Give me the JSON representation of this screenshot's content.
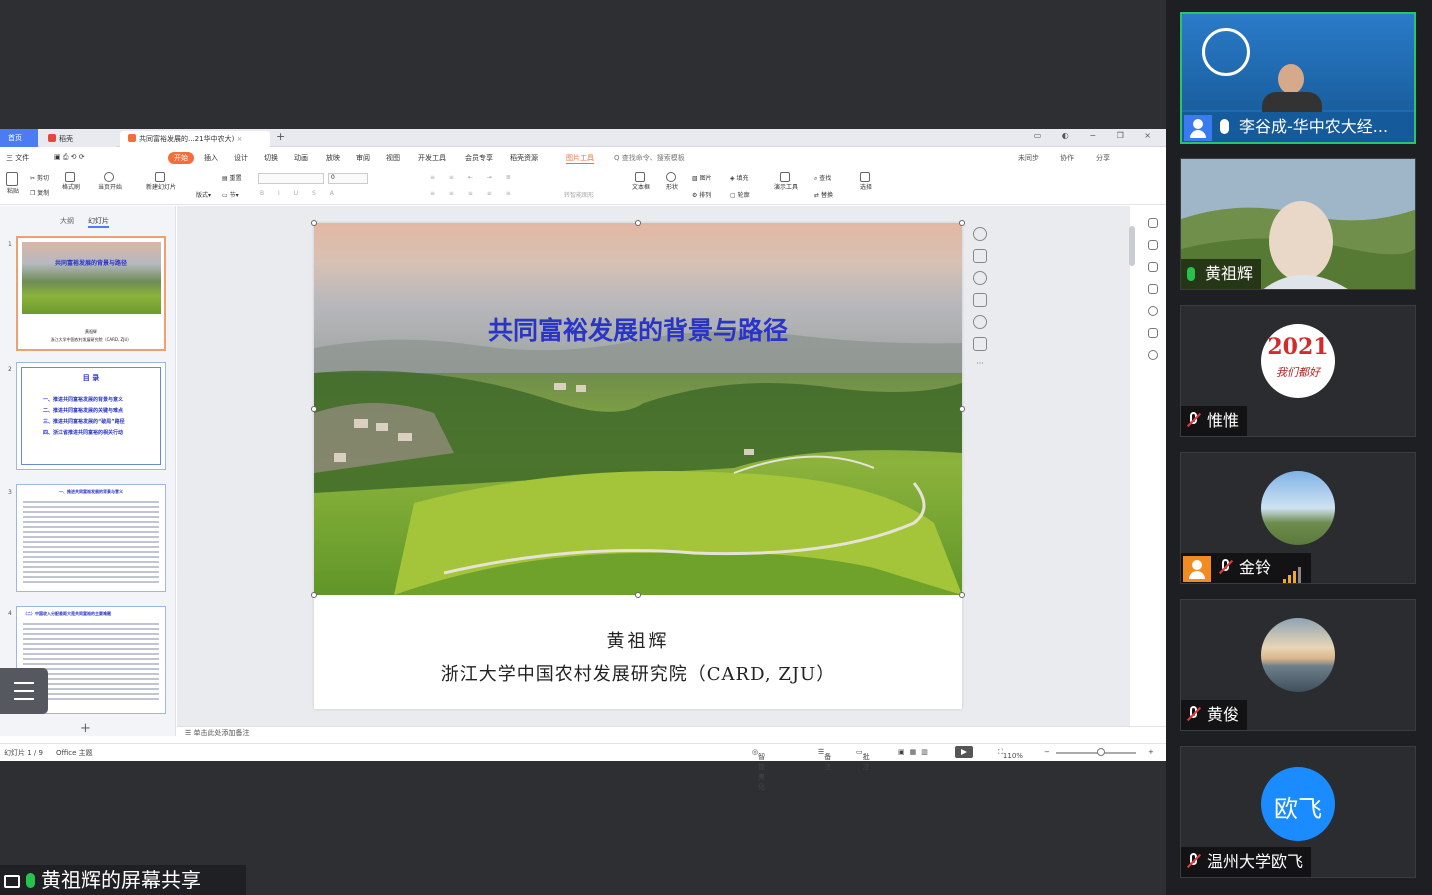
{
  "wps": {
    "tabs": [
      {
        "label": "首页"
      },
      {
        "label": "稻壳"
      },
      {
        "label": "共同富裕发展的...21华中农大)"
      }
    ],
    "menu": {
      "file": "三 文件",
      "items": [
        "开始",
        "插入",
        "设计",
        "切换",
        "动画",
        "放映",
        "审阅",
        "视图",
        "开发工具",
        "会员专享",
        "稻壳资源",
        "图片工具"
      ],
      "search": "Q 查找命令、搜索模板",
      "right": [
        "未同步",
        "协作",
        "分享"
      ]
    },
    "ribbon": {
      "paste": "粘贴",
      "cut": "剪切",
      "copy": "复制",
      "format_painter": "格式刷",
      "play_from_current": "当页开始",
      "new_slide": "新建幻灯片",
      "layout": "版式",
      "section": "节",
      "reset": "重置",
      "font_size": "0",
      "textbox": "文本框",
      "shapes": "形状",
      "picture": "图片",
      "arrange": "排列",
      "fill": "填充",
      "outline": "轮廓",
      "presenter_tools": "演示工具",
      "find": "查找",
      "replace": "替换",
      "select": "选择",
      "smartart": "转智能图形"
    },
    "leftpane": {
      "tab_outline": "大纲",
      "tab_slides": "幻灯片",
      "thumbs": [
        {
          "num": "1",
          "title": "共同富裕发展的背景与路径",
          "author": "黄祖辉",
          "inst": "浙江大学中国农村发展研究院（CARD, ZJU）"
        },
        {
          "num": "2",
          "title": "目  录",
          "lines": [
            "一、推进共同富裕发展的背景与意义",
            "二、推进共同富裕发展的关键与难点",
            "三、推进共同富裕发展的“破局”路径",
            "四、浙江省推进共同富裕的相关行动"
          ]
        },
        {
          "num": "3",
          "head": "一、推进共同富裕发展的背景与意义"
        },
        {
          "num": "4",
          "head": "（二）中国收入分配差距大是共同富裕的主要难题"
        }
      ]
    },
    "slide": {
      "title": "共同富裕发展的背景与路径",
      "author": "黄祖辉",
      "institution": "浙江大学中国农村发展研究院（CARD, ZJU）"
    },
    "notes_placeholder": "单击此处添加备注",
    "status": {
      "slide_counter": "幻灯片 1 / 9",
      "theme": "Office 主题",
      "smart_beautify": "智能美化",
      "notes": "备注",
      "comments": "批注",
      "zoom": "110%"
    }
  },
  "share_label": "黄祖辉的屏幕共享",
  "participants": [
    {
      "name": "李谷成-华中农大经...",
      "mic": "on-white",
      "host": true
    },
    {
      "name": "黄祖辉",
      "mic": "on-green",
      "speaking": true
    },
    {
      "name": "惟惟",
      "mic": "off",
      "avatar_text": "2021",
      "avatar_sub": "我们都好"
    },
    {
      "name": "金铃",
      "mic": "off",
      "host": true
    },
    {
      "name": "黄俊",
      "mic": "off"
    },
    {
      "name": "温州大学欧飞",
      "mic": "off",
      "avatar_text": "欧飞"
    }
  ],
  "colors": {
    "accent": "#4c7cf3",
    "start_tab": "#f36d3d",
    "slide_title": "#2a35c8",
    "speaking_border": "#2ac46e",
    "avatar_blue": "#1a8cff"
  }
}
